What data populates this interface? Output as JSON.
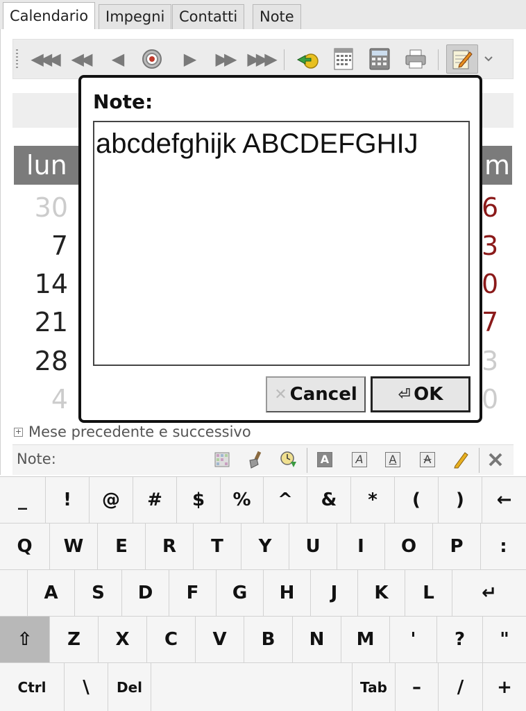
{
  "tabs": [
    {
      "label": "Calendario",
      "active": true
    },
    {
      "label": "Impegni",
      "active": false
    },
    {
      "label": "Contatti",
      "active": false
    },
    {
      "label": "Note",
      "active": false
    }
  ],
  "toolbar": {
    "icons": [
      "rewind-year-icon",
      "rewind-month-icon",
      "previous-day-icon",
      "today-target-icon",
      "next-day-icon",
      "forward-month-icon",
      "forward-year-icon",
      "goto-date-icon",
      "year-calendar-icon",
      "calculator-icon",
      "print-icon",
      "notes-edit-icon"
    ]
  },
  "calendar": {
    "header_left": "lun",
    "header_right": "m",
    "left_days": [
      "30",
      "7",
      "14",
      "21",
      "28",
      "4"
    ],
    "right_days": [
      "6",
      "3",
      "0",
      "7",
      "3",
      "0"
    ]
  },
  "colors": {
    "accent_red": "#8b1a1a",
    "header_gray": "#7b7b7b",
    "dim_day": "#cccccc"
  },
  "expander": {
    "label": "Mese precedente e successivo"
  },
  "notes_bar": {
    "label": "Note:",
    "icons": [
      "color-grid-icon",
      "brush-icon",
      "clock-down-icon",
      "bold-a-icon",
      "italic-a-icon",
      "underline-a-icon",
      "strike-a-icon",
      "pencil-icon",
      "delete-x-icon"
    ]
  },
  "dialog": {
    "title": "Note:",
    "text": "abcdefghijk ABCDEFGHIJ",
    "cancel_label": "Cancel",
    "ok_label": "OK"
  },
  "keyboard": {
    "row1": [
      "_",
      "!",
      "@",
      "#",
      "$",
      "%",
      "^",
      "&",
      "*",
      "(",
      ")",
      "←"
    ],
    "row2": [
      "Q",
      "W",
      "E",
      "R",
      "T",
      "Y",
      "U",
      "I",
      "O",
      "P",
      ":"
    ],
    "row3": [
      "A",
      "S",
      "D",
      "F",
      "G",
      "H",
      "J",
      "K",
      "L",
      "↵"
    ],
    "row4": [
      "⇧",
      "Z",
      "X",
      "C",
      "V",
      "B",
      "N",
      "M",
      "'",
      "?",
      "\""
    ],
    "row5": [
      "Ctrl",
      "\\",
      "Del",
      "",
      "Tab",
      "–",
      "/",
      "+"
    ]
  }
}
